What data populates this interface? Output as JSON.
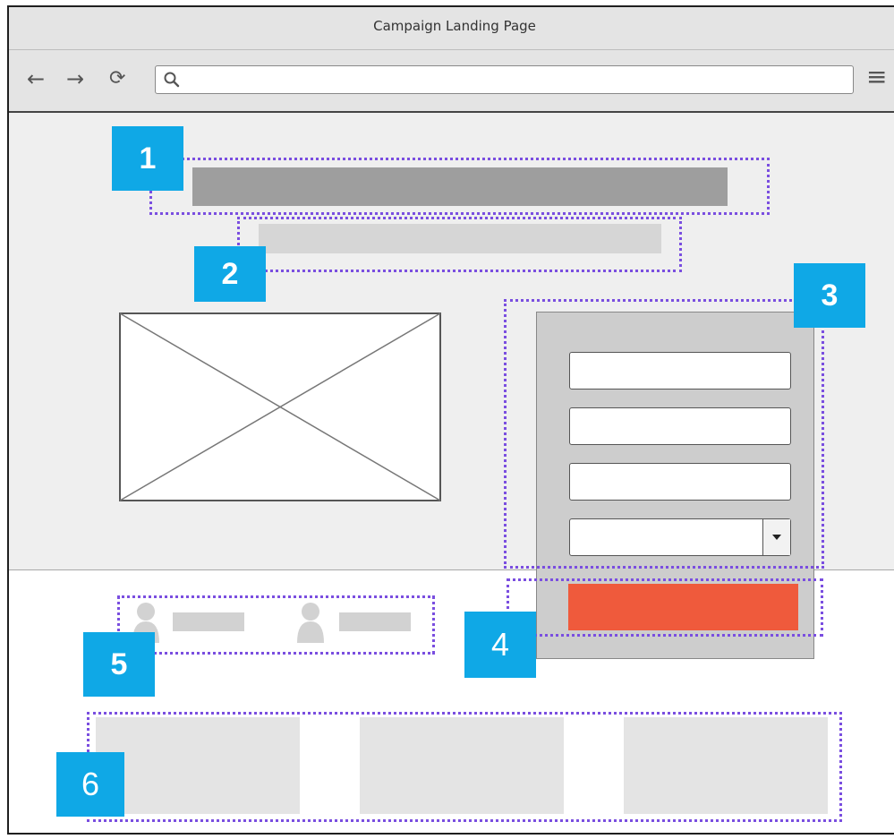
{
  "window": {
    "title": "Campaign Landing Page"
  },
  "toolbar": {
    "back_icon": "←",
    "forward_icon": "→",
    "reload_icon": "⟳",
    "menu_icon": "≡",
    "url_value": ""
  },
  "callouts": [
    "1",
    "2",
    "3",
    "4",
    "5",
    "6"
  ],
  "colors": {
    "callout_bg": "#0fa8e6",
    "dotted_outline": "#7a4ee0",
    "submit_button": "#ef5a3c",
    "headline_bar": "#9e9e9e",
    "subheadline_bar": "#d6d6d6"
  }
}
